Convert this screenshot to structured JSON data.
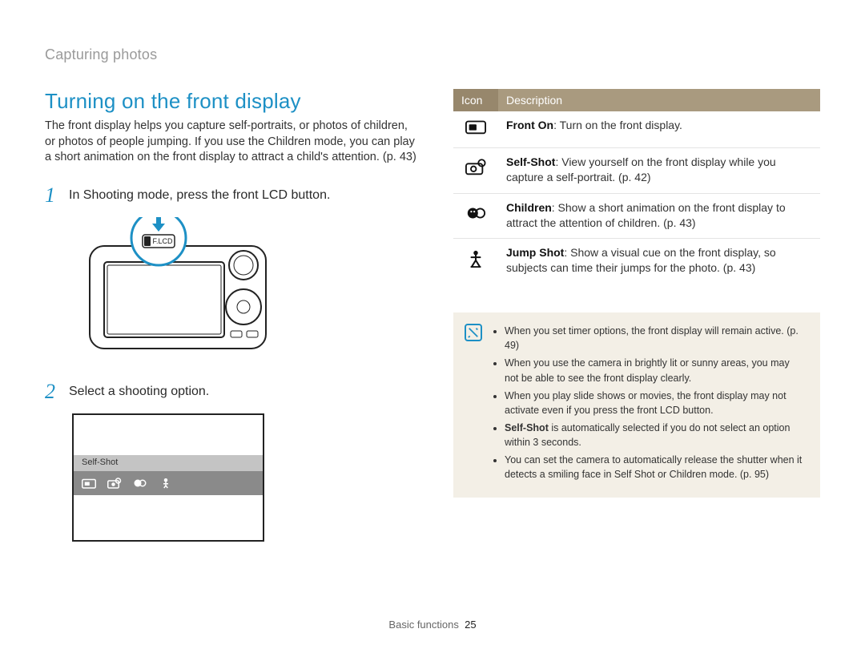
{
  "breadcrumb": "Capturing photos",
  "title": "Turning on the front display",
  "intro": "The front display helps you capture self-portraits, or photos of children, or photos of people jumping. If you use the Children mode, you can play a short animation on the front display to attract a child's attention. (p. 43)",
  "steps": [
    {
      "num": "1",
      "text": "In Shooting mode, press the front LCD button."
    },
    {
      "num": "2",
      "text": "Select a shooting option."
    }
  ],
  "camera_label": "F.LCD",
  "menu_selected": "Self-Shot",
  "table": {
    "head_icon": "Icon",
    "head_desc": "Description",
    "rows": [
      {
        "icon": "front-on-icon",
        "label": "Front On",
        "text": ": Turn on the front display."
      },
      {
        "icon": "self-shot-icon",
        "label": "Self-Shot",
        "text": ": View yourself on the front display while you capture a self-portrait. (p. 42)"
      },
      {
        "icon": "children-icon",
        "label": "Children",
        "text": ": Show a short animation on the front display to attract the attention of children. (p. 43)"
      },
      {
        "icon": "jump-shot-icon",
        "label": "Jump Shot",
        "text": ": Show a visual cue on the front display, so subjects can time their jumps for the photo. (p. 43)"
      }
    ]
  },
  "notes": [
    "When you set timer options, the front display will remain active. (p. 49)",
    "When you use the camera in brightly lit or sunny areas, you may not be able to see the front display clearly.",
    "When you play slide shows or movies, the front display may not activate even if you press the front LCD button.",
    "<b>Self-Shot</b> is automatically selected if you do not select an option within 3 seconds.",
    "You can set the camera to automatically release the shutter when it detects a smiling face in Self Shot or Children mode. (p. 95)"
  ],
  "footer_section": "Basic functions",
  "footer_page": "25"
}
